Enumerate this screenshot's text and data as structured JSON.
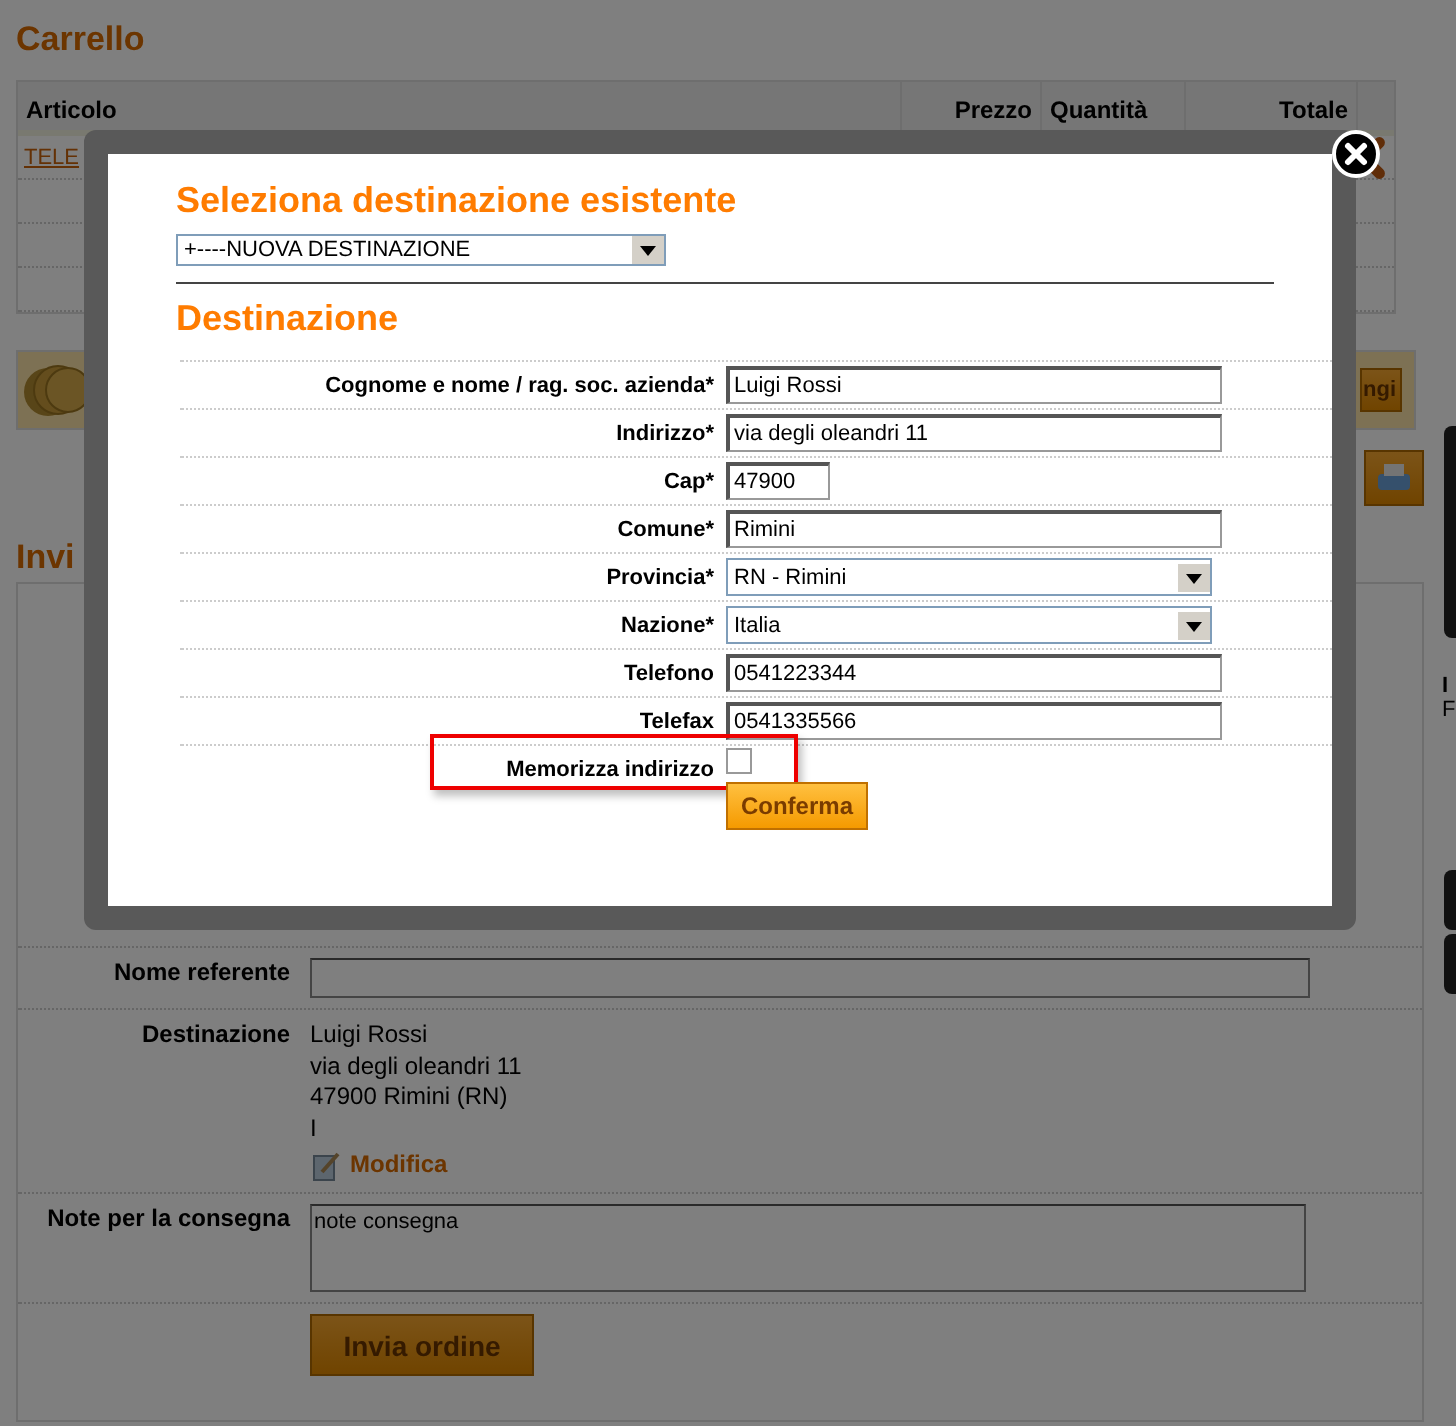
{
  "cart": {
    "title": "Carrello",
    "columns": [
      "Articolo",
      "Prezzo",
      "Quantità",
      "Totale"
    ],
    "rows": [
      {
        "item": "TELE"
      },
      {
        "item": ""
      },
      {
        "item": ""
      },
      {
        "item": ""
      }
    ],
    "coupon_button": "ngi"
  },
  "order": {
    "title": "Invi",
    "side_letters": [
      "I",
      "F"
    ],
    "contact_label": "Nome referente",
    "destination_label": "Destinazione",
    "destination_lines": [
      "Luigi Rossi",
      "via degli oleandri 11",
      "47900 Rimini (RN)",
      "I"
    ],
    "edit_link": "Modifica",
    "notes_label": "Note per la consegna",
    "notes_value": "note consegna",
    "submit": "Invia ordine"
  },
  "modal": {
    "existing_title": "Seleziona destinazione esistente",
    "existing_select": "+----NUOVA DESTINAZIONE",
    "destination_title": "Destinazione",
    "fields": [
      {
        "label": "Cognome e nome / rag. soc. azienda*",
        "value": "Luigi Rossi",
        "kind": "text"
      },
      {
        "label": "Indirizzo*",
        "value": "via degli oleandri 11",
        "kind": "text"
      },
      {
        "label": "Cap*",
        "value": "47900",
        "kind": "short"
      },
      {
        "label": "Comune*",
        "value": "Rimini",
        "kind": "text"
      },
      {
        "label": "Provincia*",
        "value": "RN - Rimini",
        "kind": "select"
      },
      {
        "label": "Nazione*",
        "value": "Italia",
        "kind": "select"
      },
      {
        "label": "Telefono",
        "value": "0541223344",
        "kind": "text"
      },
      {
        "label": "Telefax",
        "value": "0541335566",
        "kind": "text"
      }
    ],
    "save_address": {
      "label": "Memorizza indirizzo",
      "checked": false,
      "highlighted": true
    },
    "confirm": "Conferma"
  }
}
